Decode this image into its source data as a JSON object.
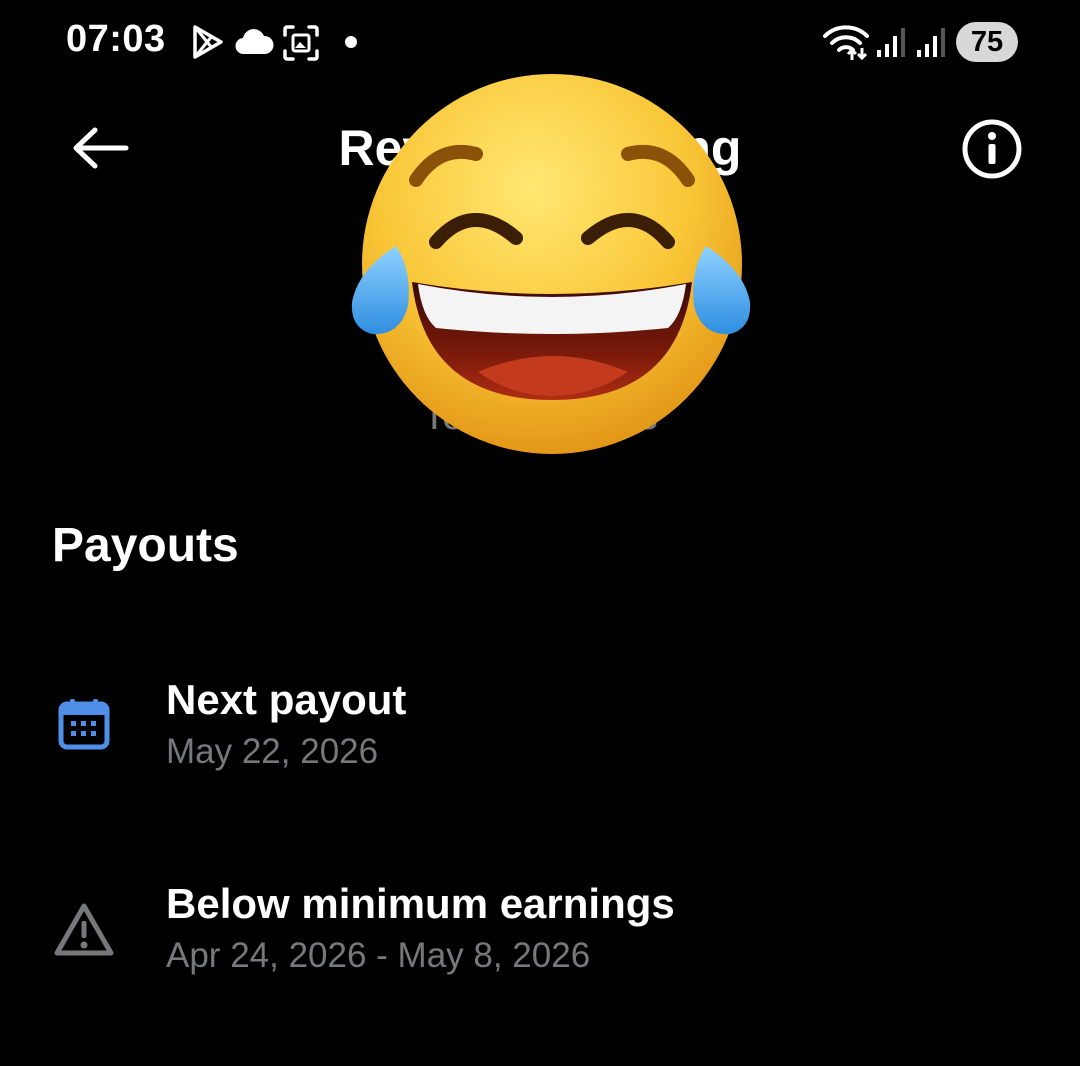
{
  "status_bar": {
    "time": "07:03",
    "battery": "75",
    "icons": [
      "play-store-icon",
      "cloud-icon",
      "screenshot-icon",
      "dot-icon",
      "wifi-icon",
      "signal-icon",
      "signal-icon"
    ]
  },
  "header": {
    "title": "Revenue sharing",
    "back_icon": "back-arrow-icon",
    "info_icon": "info-icon"
  },
  "summary": {
    "total_label": "Total payouts"
  },
  "overlay": {
    "emoji": "face-with-tears-of-joy"
  },
  "payouts": {
    "heading": "Payouts",
    "items": [
      {
        "icon": "calendar-icon",
        "title": "Next payout",
        "subtitle": "May 22, 2026",
        "icon_color": "#4f8fe8"
      },
      {
        "icon": "warning-icon",
        "title": "Below minimum earnings",
        "subtitle": "Apr 24, 2026 - May 8, 2026",
        "icon_color": "#76787b"
      }
    ]
  },
  "colors": {
    "background": "#000000",
    "text_primary": "#ffffff",
    "text_secondary": "#76787b",
    "accent": "#4f8fe8"
  }
}
